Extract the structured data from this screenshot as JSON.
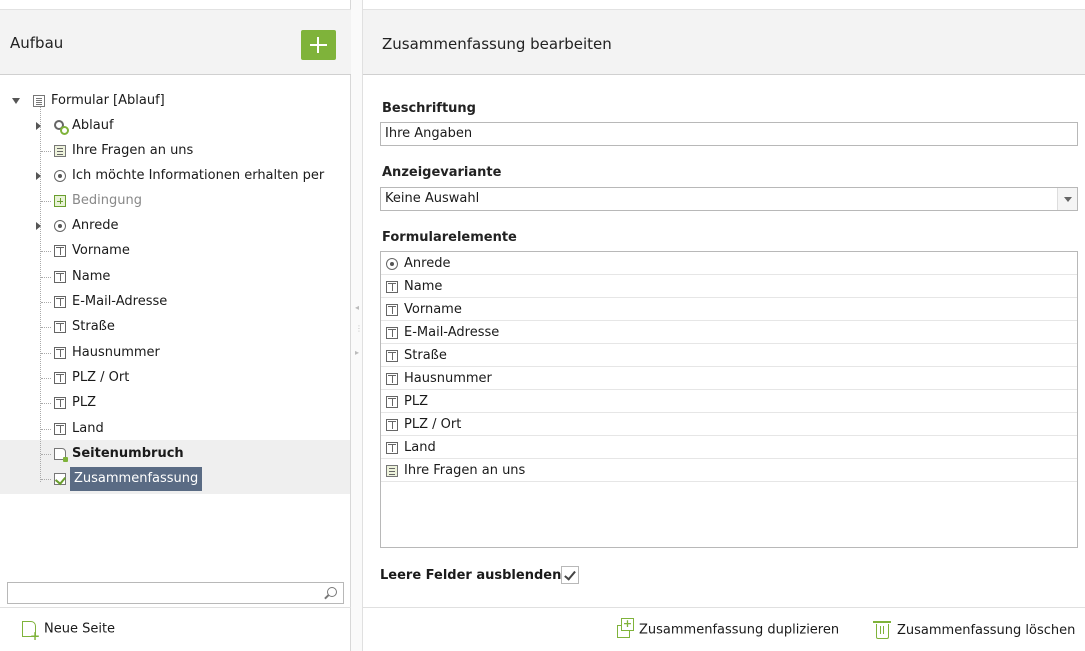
{
  "left": {
    "title": "Aufbau",
    "tree": {
      "root": "Formular [Ablauf]",
      "items": [
        {
          "label": "Ablauf",
          "icon": "gear-icon"
        },
        {
          "label": "Ihre Fragen an uns",
          "icon": "textarea-icon"
        },
        {
          "label": "Ich möchte Informationen erhalten per",
          "icon": "radio-icon"
        },
        {
          "label": "Bedingung",
          "icon": "condition-icon"
        },
        {
          "label": "Anrede",
          "icon": "radio-icon"
        },
        {
          "label": "Vorname",
          "icon": "text-field-icon"
        },
        {
          "label": "Name",
          "icon": "text-field-icon"
        },
        {
          "label": "E-Mail-Adresse",
          "icon": "text-field-icon"
        },
        {
          "label": "Straße",
          "icon": "text-field-icon"
        },
        {
          "label": "Hausnummer",
          "icon": "text-field-icon"
        },
        {
          "label": "PLZ / Ort",
          "icon": "text-field-icon"
        },
        {
          "label": "PLZ",
          "icon": "text-field-icon"
        },
        {
          "label": "Land",
          "icon": "text-field-icon"
        },
        {
          "label": "Seitenumbruch",
          "icon": "page-break-icon"
        },
        {
          "label": "Zusammenfassung",
          "icon": "summary-icon"
        }
      ]
    },
    "search": {
      "value": ""
    },
    "footer": {
      "new_page": "Neue Seite"
    }
  },
  "right": {
    "title": "Zusammenfassung bearbeiten",
    "beschriftung": {
      "label": "Beschriftung",
      "value": "Ihre Angaben"
    },
    "anzeigevariante": {
      "label": "Anzeigevariante",
      "value": "Keine Auswahl"
    },
    "formularelemente": {
      "label": "Formularelemente",
      "items": [
        {
          "label": "Anrede",
          "icon": "radio-icon"
        },
        {
          "label": "Name",
          "icon": "text-field-icon"
        },
        {
          "label": "Vorname",
          "icon": "text-field-icon"
        },
        {
          "label": "E-Mail-Adresse",
          "icon": "text-field-icon"
        },
        {
          "label": "Straße",
          "icon": "text-field-icon"
        },
        {
          "label": "Hausnummer",
          "icon": "text-field-icon"
        },
        {
          "label": "PLZ",
          "icon": "text-field-icon"
        },
        {
          "label": "PLZ / Ort",
          "icon": "text-field-icon"
        },
        {
          "label": "Land",
          "icon": "text-field-icon"
        },
        {
          "label": "Ihre Fragen an uns",
          "icon": "textarea-icon"
        }
      ]
    },
    "leere_felder": {
      "label": "Leere Felder ausblenden",
      "checked": true
    },
    "footer": {
      "duplicate": "Zusammenfassung duplizieren",
      "delete": "Zusammenfassung löschen"
    }
  },
  "colors": {
    "accent": "#7fb33a",
    "selection": "#5a6b84"
  }
}
